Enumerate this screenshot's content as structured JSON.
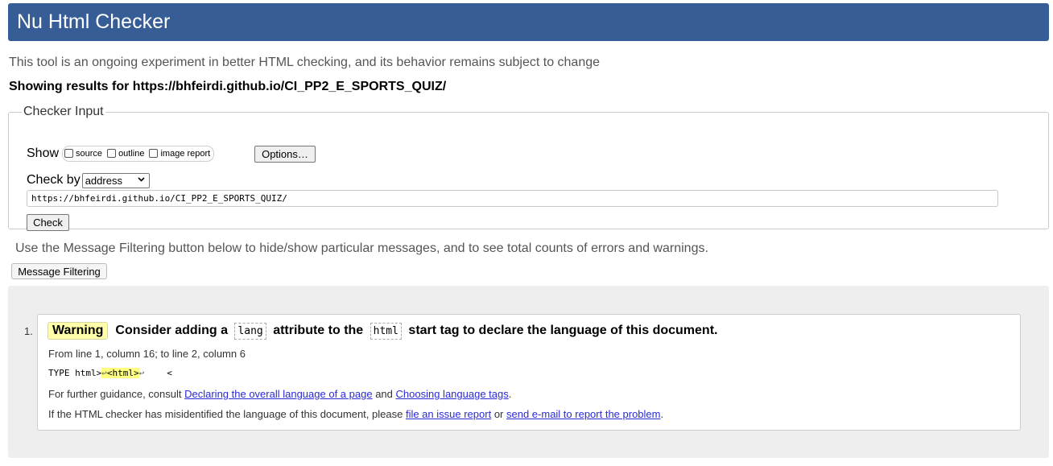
{
  "header": {
    "title": "Nu Html Checker"
  },
  "intro": "This tool is an ongoing experiment in better HTML checking, and its behavior remains subject to change",
  "showing": "Showing results for https://bhfeirdi.github.io/CI_PP2_E_SPORTS_QUIZ/",
  "checker": {
    "legend": "Checker Input",
    "show_label": "Show",
    "show_options": [
      "source",
      "outline",
      "image report"
    ],
    "options_button": "Options…",
    "checkby_label": "Check by",
    "checkby_value": "address",
    "url_value": "https://bhfeirdi.github.io/CI_PP2_E_SPORTS_QUIZ/",
    "check_button": "Check"
  },
  "filter": {
    "note": "Use the Message Filtering button below to hide/show particular messages, and to see total counts of errors and warnings.",
    "button": "Message Filtering"
  },
  "messages": [
    {
      "number": "1.",
      "type": "Warning",
      "text_parts": [
        "Consider adding a",
        "lang",
        "attribute to the",
        "html",
        "start tag to declare the language of this document."
      ],
      "location": "From line 1, column 16; to line 2, column 6",
      "extract": {
        "before": "TYPE html>",
        "lf1": "↩",
        "highlight": "<html>",
        "lf2": "↩",
        "after": "<"
      },
      "guidance": {
        "prefix": "For further guidance, consult",
        "link1": "Declaring the overall language of a page",
        "and": "and",
        "link2": "Choosing language tags",
        "suffix": "."
      },
      "misidentified": {
        "prefix": "If the HTML checker has misidentified the language of this document, please",
        "link1": "file an issue report",
        "or": "or",
        "link2": "send e-mail to report the problem",
        "suffix": "."
      }
    }
  ]
}
